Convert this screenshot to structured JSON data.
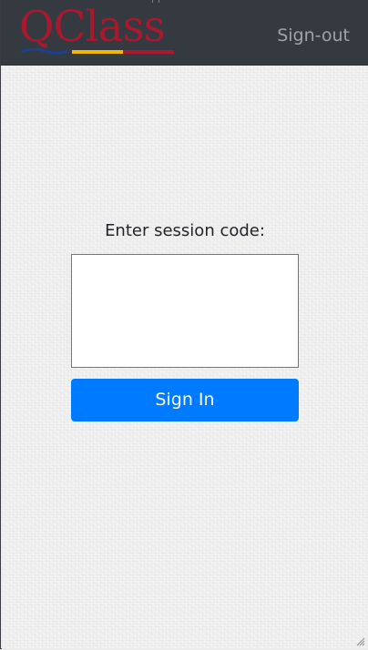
{
  "app": {
    "logo_text": "QClass",
    "brand_colors": {
      "logo_red": "#a6192e",
      "bar_blue": "#1f3f8f",
      "bar_gold": "#f2b705",
      "bar_red": "#a6192e"
    }
  },
  "navbar": {
    "signout_label": "Sign-out",
    "background": "#343a40"
  },
  "login": {
    "prompt": "Enter session code:",
    "code_value": "",
    "code_placeholder": "",
    "signin_label": "Sign In",
    "button_color": "#007bff"
  },
  "icons": {
    "resize": "resize-grip-icon"
  }
}
